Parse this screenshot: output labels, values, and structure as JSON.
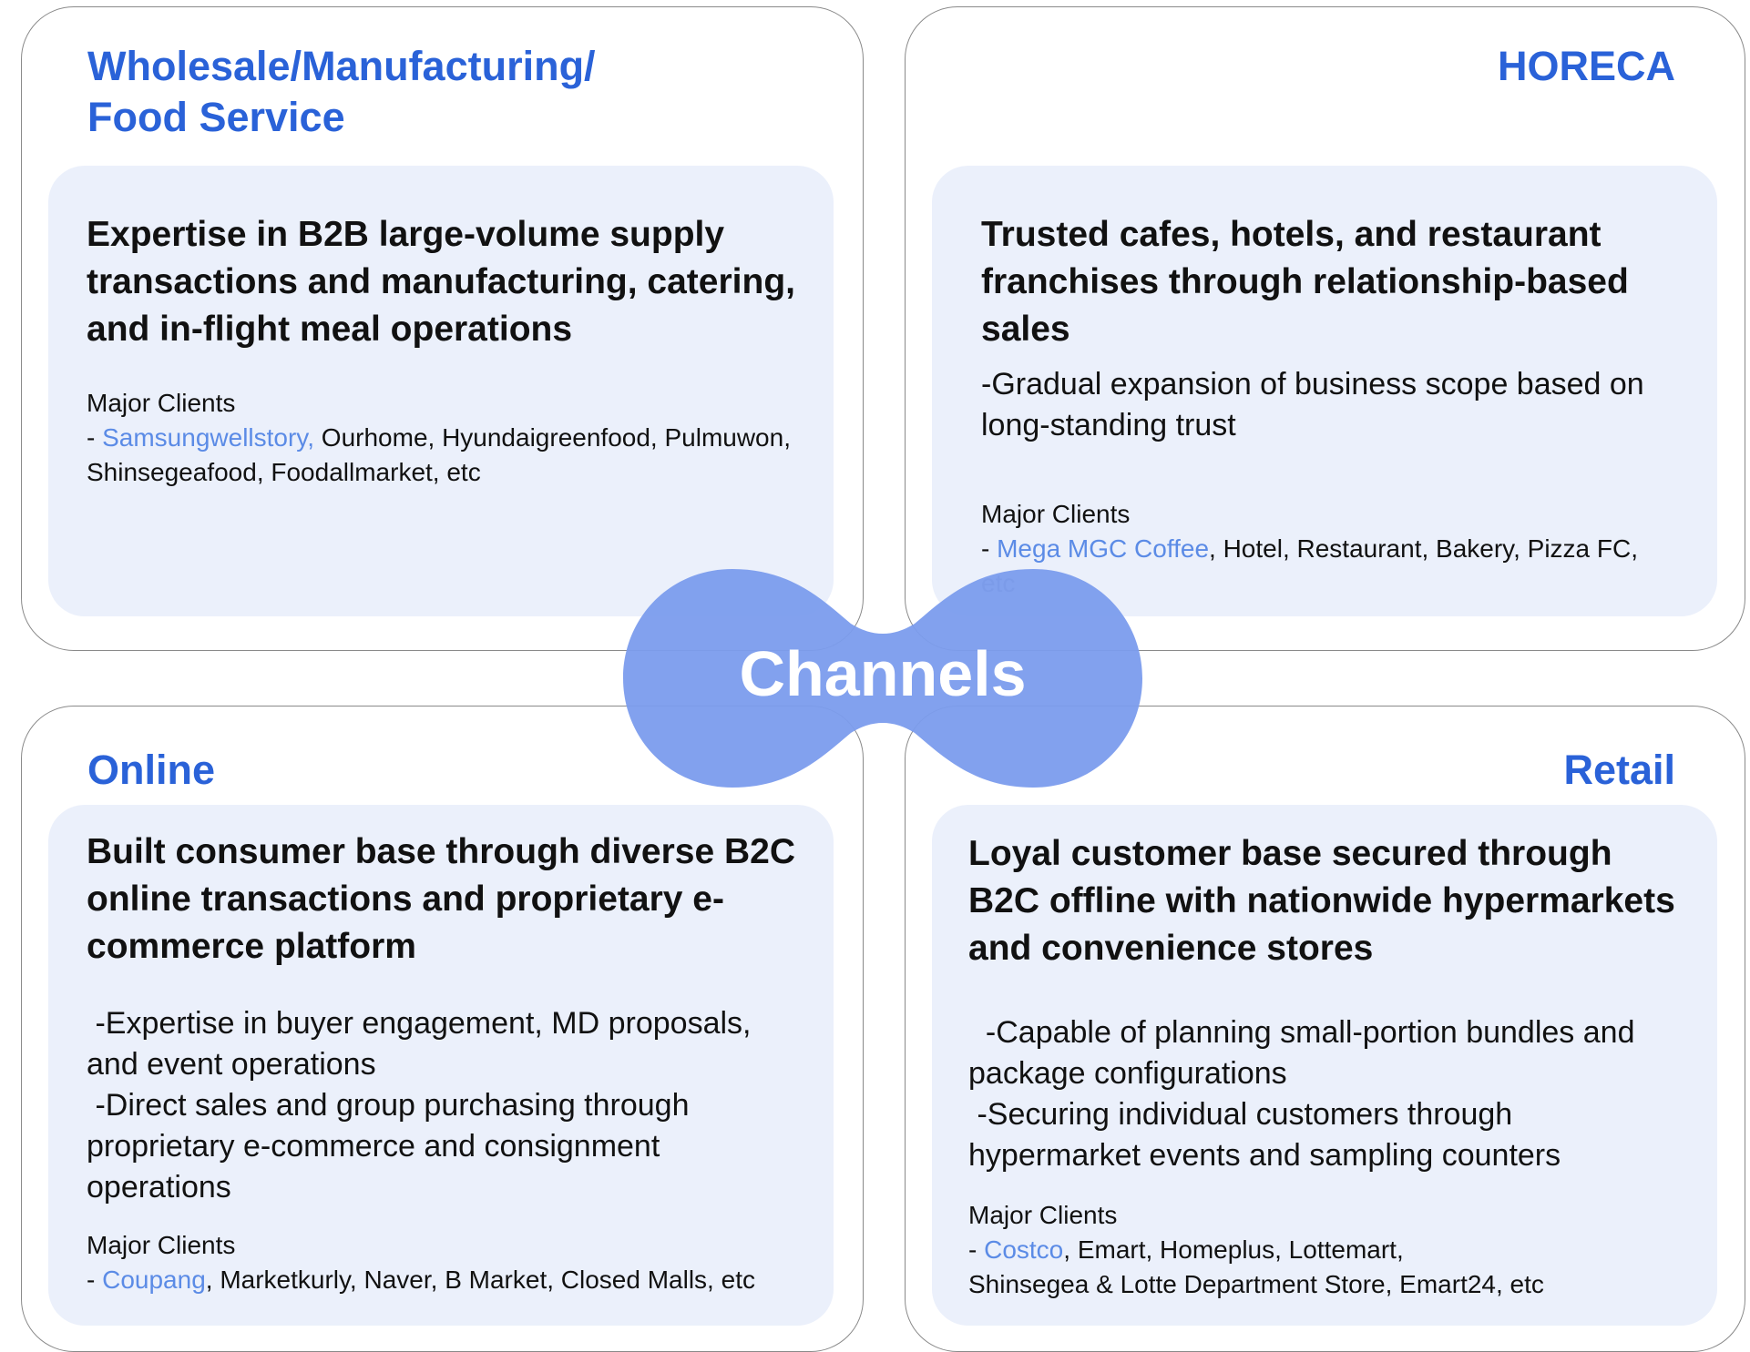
{
  "center": {
    "label": "Channels",
    "color": "#7b9ced"
  },
  "colors": {
    "accent": "#2a62d8",
    "highlight": "#5b8be6",
    "panel": "#ebf0fb",
    "border": "#8a8a8a"
  },
  "quadrants": {
    "top_left": {
      "title": "Wholesale/Manufacturing/\nFood Service",
      "heading": "Expertise in B2B large-volume supply transactions and manufacturing, catering, and in-flight meal operations",
      "clients_label": "Major Clients",
      "clients_prefix": "- ",
      "clients_highlight": "Samsungwellstory,",
      "clients_rest": " Ourhome, Hyundaigreenfood, Pulmuwon, Shinsegeafood, Foodallmarket, etc"
    },
    "top_right": {
      "title": "HORECA",
      "heading": "Trusted cafes, hotels, and restaurant franchises through relationship-based sales",
      "description": "-Gradual expansion of business scope based on long-standing trust",
      "clients_label": "Major Clients",
      "clients_prefix": "- ",
      "clients_highlight": "Mega MGC Coffee",
      "clients_rest": ", Hotel, Restaurant, Bakery, Pizza FC,",
      "clients_tail": "etc"
    },
    "bottom_left": {
      "title": "Online",
      "heading": "Built consumer base through diverse B2C online transactions and proprietary e-commerce platform",
      "bullet1": " -Expertise in buyer engagement, MD proposals, and event operations",
      "bullet2": " -Direct sales and group purchasing through proprietary e-commerce and consignment operations",
      "clients_label": "Major Clients",
      "clients_prefix": "- ",
      "clients_highlight": "Coupang",
      "clients_rest": ", Marketkurly, Naver, B Market, Closed Malls, etc"
    },
    "bottom_right": {
      "title": "Retail",
      "heading": "Loyal customer base secured through B2C offline with nationwide hypermarkets and convenience stores",
      "bullet1": "  -Capable of planning small-portion bundles and package configurations",
      "bullet2": " -Securing individual customers through hypermarket events and sampling counters",
      "clients_label": "Major Clients",
      "clients_prefix": "- ",
      "clients_highlight": "Costco",
      "clients_rest": ", Emart, Homeplus, Lottemart,",
      "clients_line2": "Shinsegea & Lotte Department Store, Emart24, etc"
    }
  }
}
